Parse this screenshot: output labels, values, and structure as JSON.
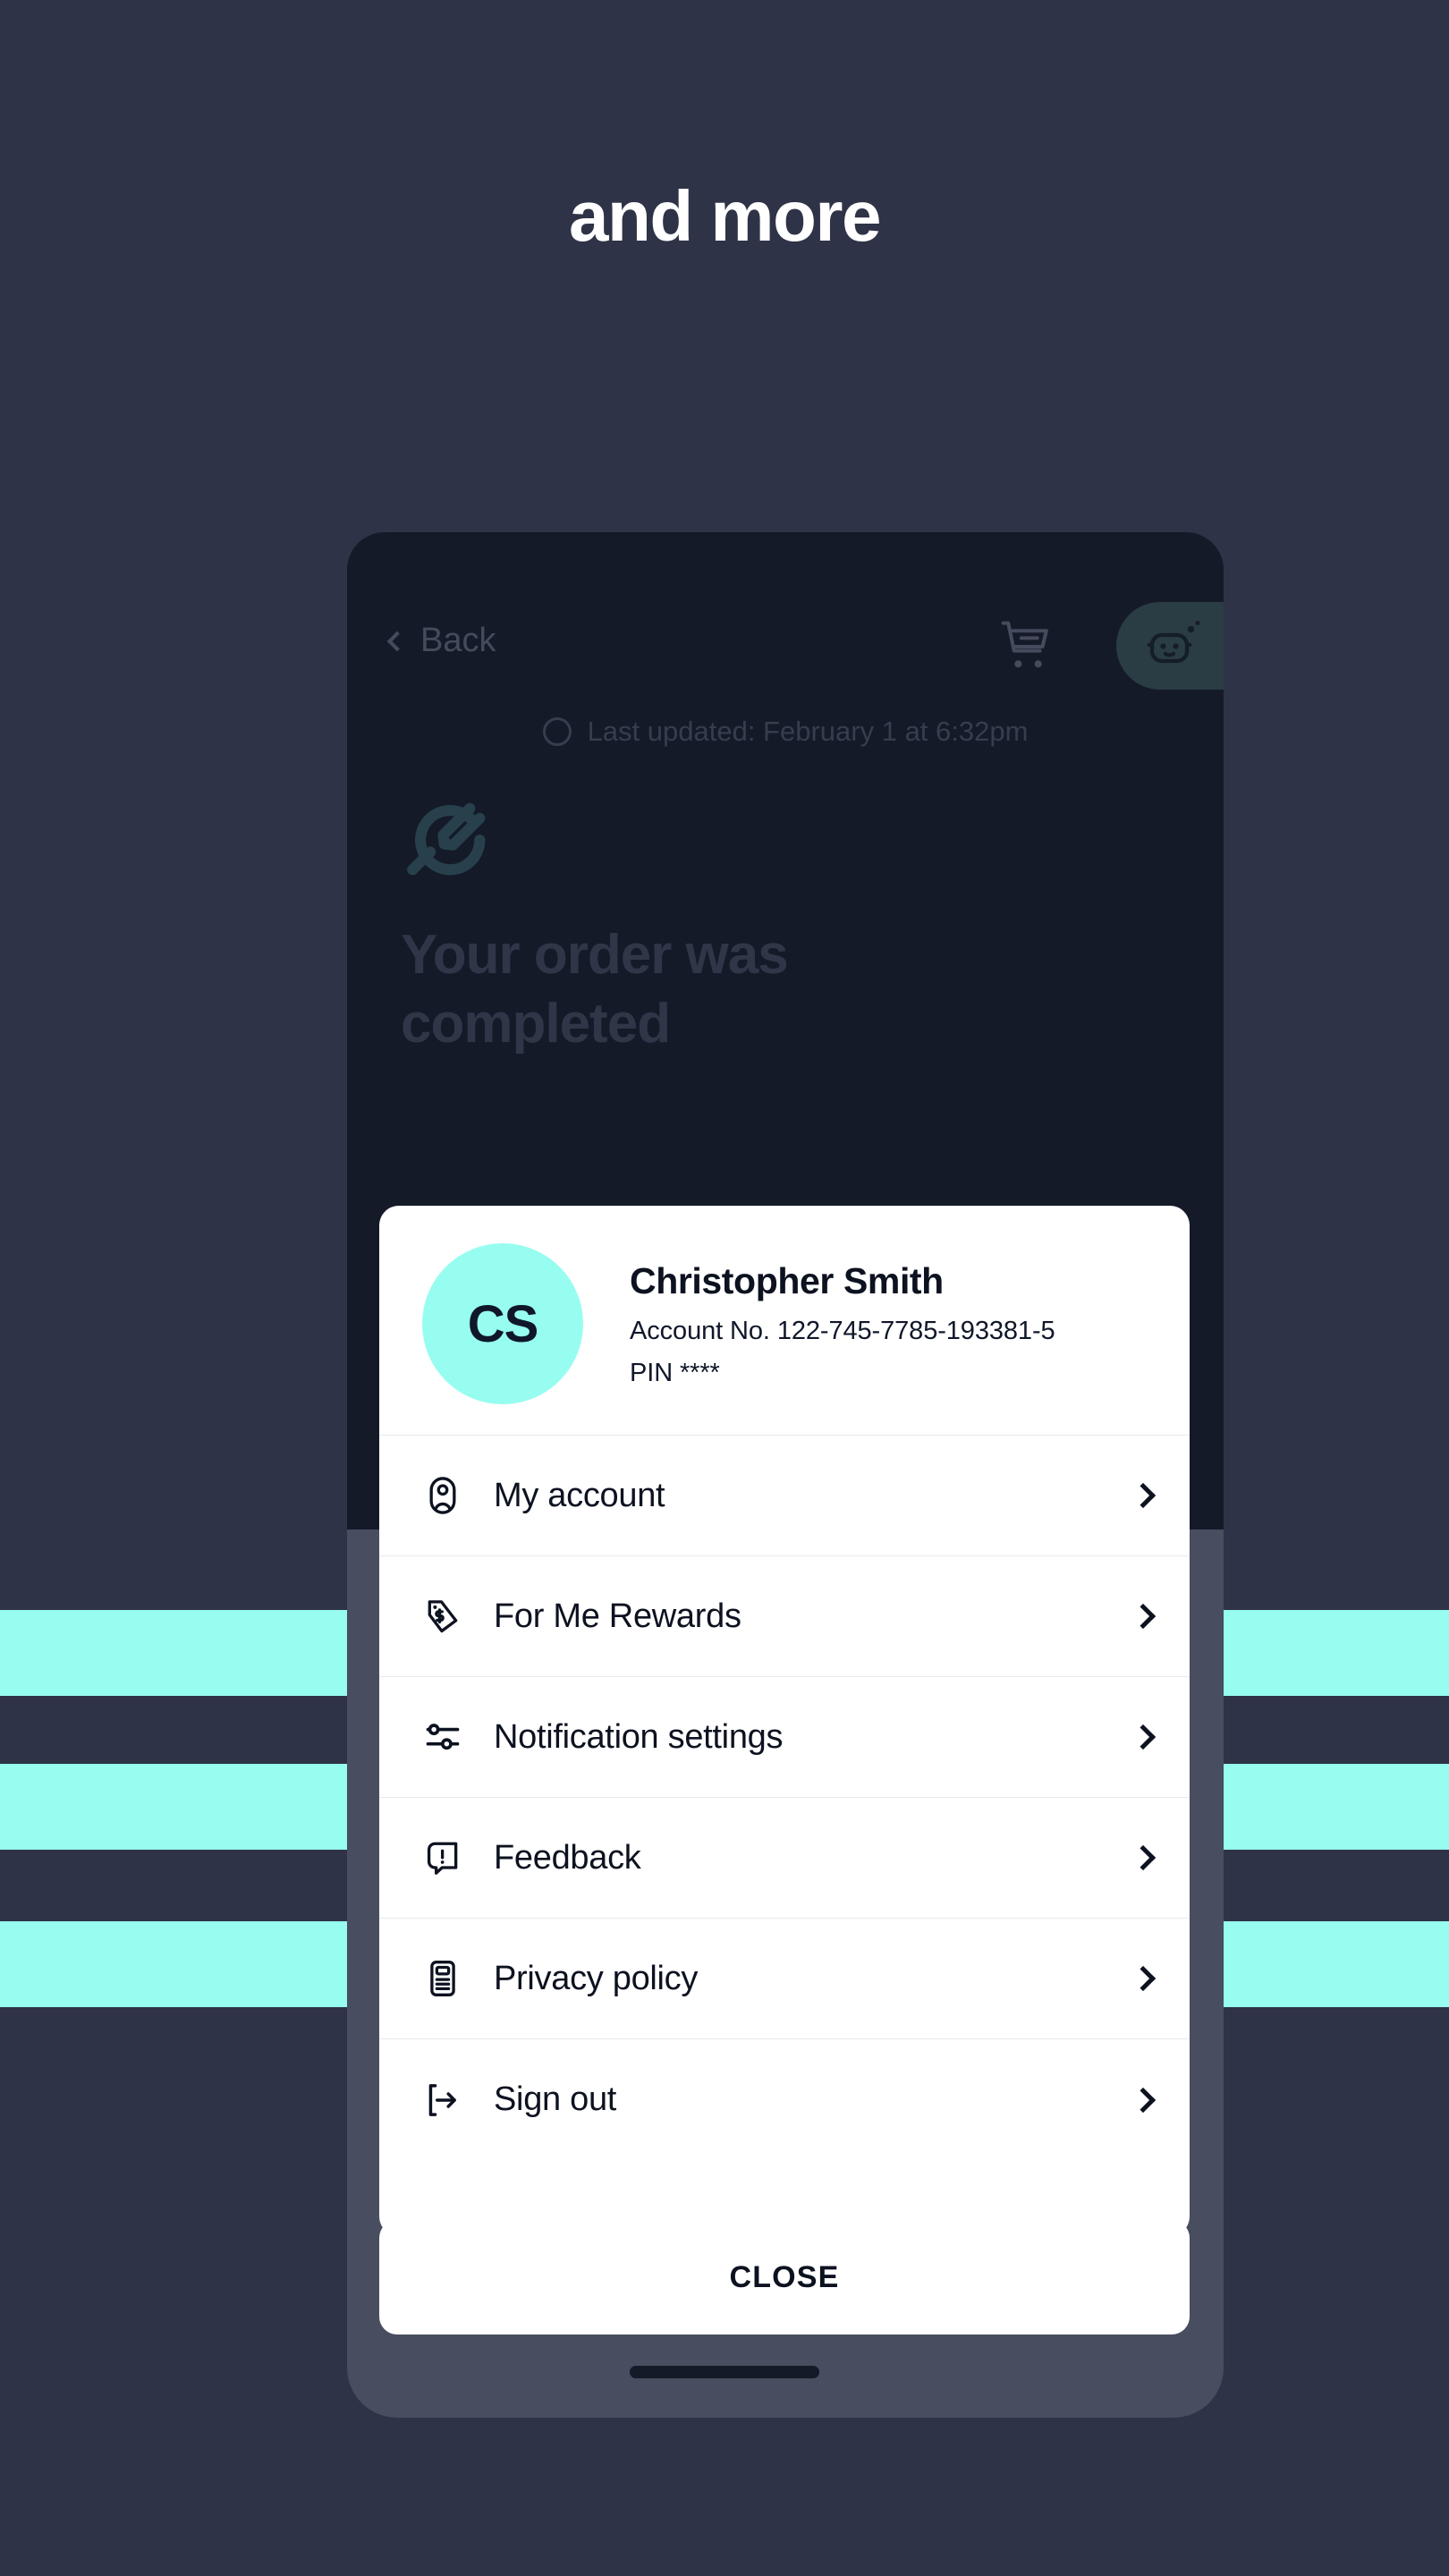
{
  "page": {
    "headline": "and more",
    "background_color": "#2e3347",
    "accent_color": "#97fdf0"
  },
  "decor": {
    "bars": [
      "cyan-bar-1",
      "cyan-bar-2",
      "cyan-bar-3"
    ],
    "bar_color": "#97fdf0"
  },
  "phone_screen": {
    "topbar": {
      "back_label": "Back",
      "back_icon": "chevron-left-icon",
      "cart_icon": "shopping-cart-icon",
      "assistant_icon": "chat-bot-icon"
    },
    "last_updated": {
      "refresh_icon": "refresh-icon",
      "text": "Last updated: February 1 at 6:32pm"
    },
    "brand_logo_icon": "wrench-swoosh-logo-icon",
    "order_heading": "Your order was completed",
    "tabbar_icons": [
      "home-icon",
      "card-icon",
      "circle-icon",
      "alert-triangle-icon",
      "profile-icon"
    ]
  },
  "account_sheet": {
    "avatar_initials": "CS",
    "customer_name": "Christopher Smith",
    "account_number_label": "Account No. 122-745-7785-193381-5",
    "pin_label": "PIN ****",
    "menu": [
      {
        "label": "My account",
        "icon": "user-circle-icon",
        "chevron": "chevron-right-icon"
      },
      {
        "label": "For Me Rewards",
        "icon": "price-tag-dollar-icon",
        "chevron": "chevron-right-icon"
      },
      {
        "label": "Notification settings",
        "icon": "sliders-icon",
        "chevron": "chevron-right-icon"
      },
      {
        "label": "Feedback",
        "icon": "chat-alert-icon",
        "chevron": "chevron-right-icon"
      },
      {
        "label": "Privacy policy",
        "icon": "document-icon",
        "chevron": "chevron-right-icon"
      },
      {
        "label": "Sign out",
        "icon": "logout-icon",
        "chevron": "chevron-right-icon"
      }
    ]
  },
  "close_button": {
    "label": "CLOSE"
  }
}
